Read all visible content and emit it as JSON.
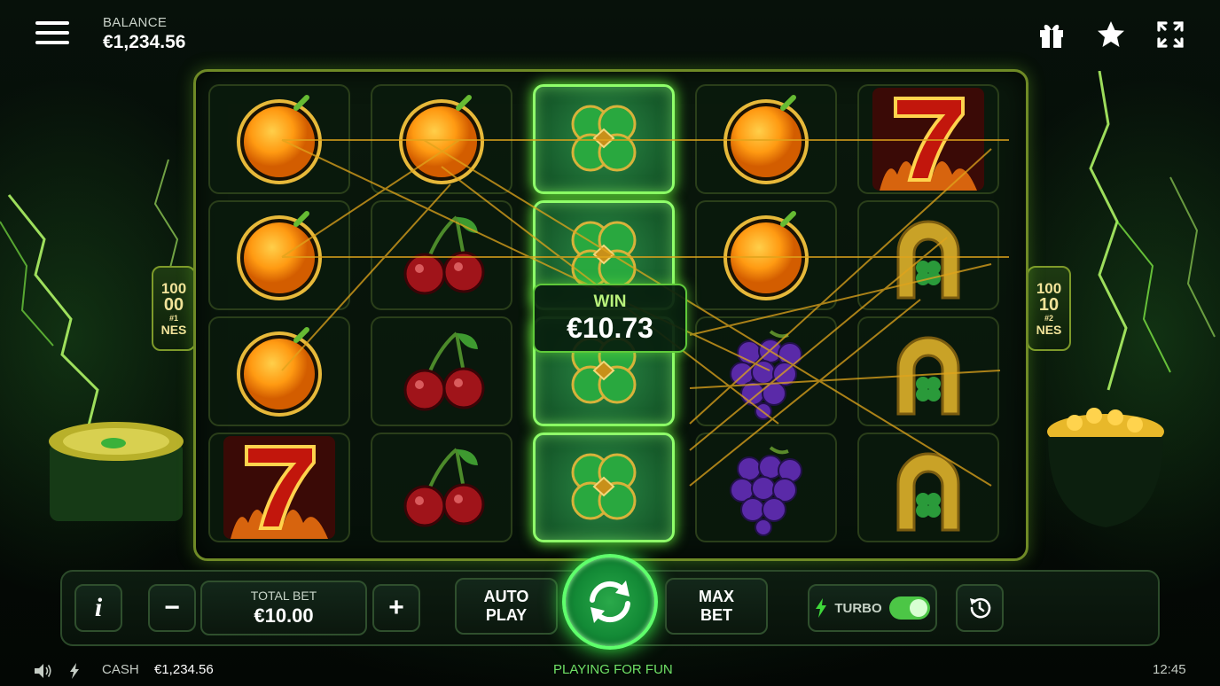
{
  "header": {
    "balance_label": "BALANCE",
    "balance_value": "€1,234.56",
    "icons": [
      "menu-icon",
      "gift-icon",
      "star-icon",
      "fullscreen-icon"
    ]
  },
  "reels": [
    [
      "orange",
      "orange",
      "orange",
      "seven"
    ],
    [
      "orange",
      "cherry",
      "cherry",
      "cherry"
    ],
    [
      "clover",
      "clover",
      "clover",
      "clover"
    ],
    [
      "orange",
      "orange",
      "grapes",
      "grapes"
    ],
    [
      "seven",
      "horseshoe",
      "horseshoe",
      "horseshoe"
    ]
  ],
  "winning_reel": 3,
  "side_badges": {
    "left": [
      "100",
      "00",
      "#1",
      "NES"
    ],
    "right": [
      "100",
      "10",
      "#2",
      "NES"
    ]
  },
  "win": {
    "label": "WIN",
    "amount": "€10.73"
  },
  "controls": {
    "total_bet_label": "TOTAL BET",
    "total_bet_value": "€10.00",
    "minus": "−",
    "plus": "+",
    "info": "i",
    "auto_play": [
      "AUTO",
      "PLAY"
    ],
    "max_bet": [
      "MAX",
      "BET"
    ],
    "turbo_label": "TURBO",
    "turbo_on": true
  },
  "status_bar": {
    "cash_label": "CASH",
    "cash_value": "€1,234.56",
    "mode": "PLAYING FOR FUN",
    "time": "12:45"
  },
  "colors": {
    "accent_green": "#5fff6c",
    "gold": "#c9a227",
    "win_text": "#b9f27c"
  }
}
